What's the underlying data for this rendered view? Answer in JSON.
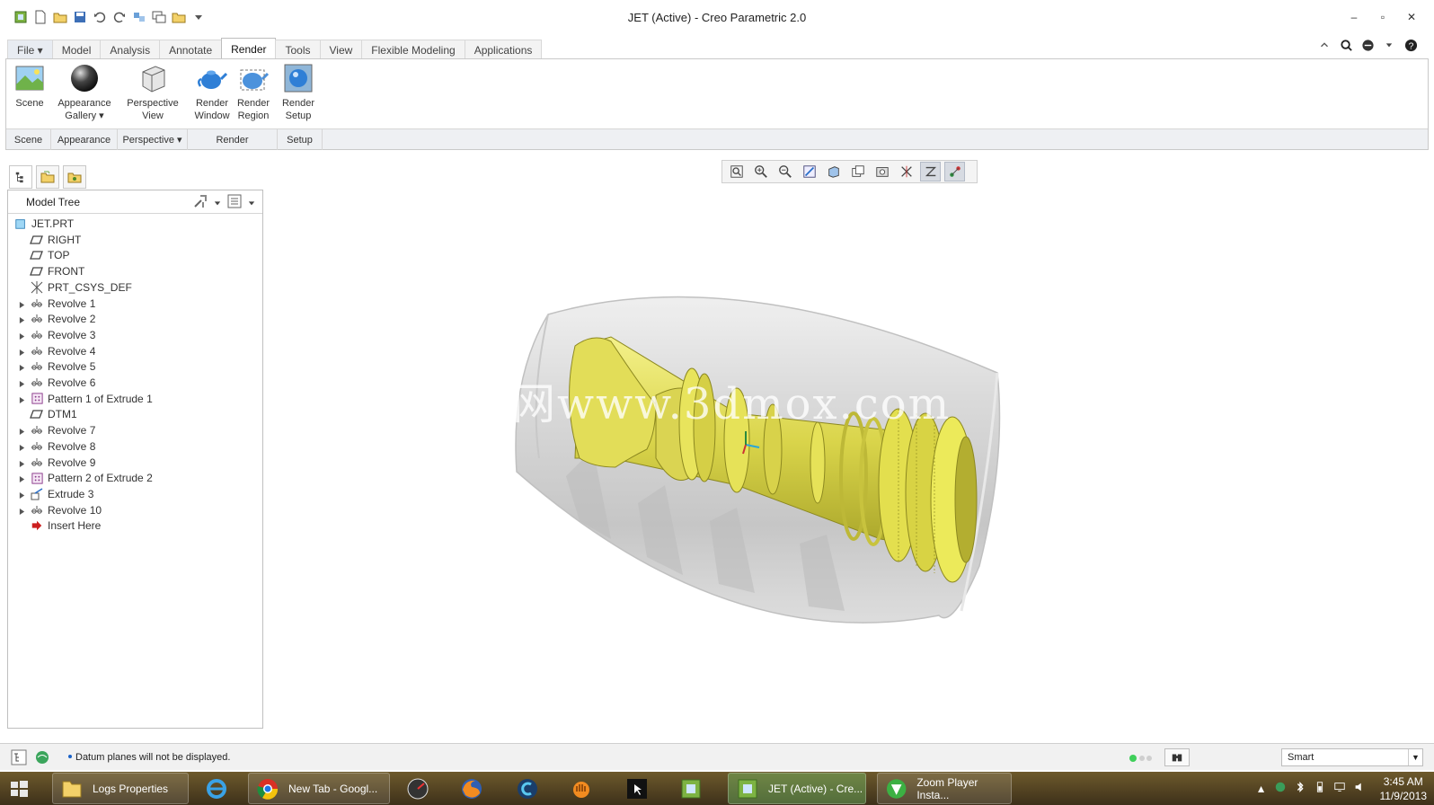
{
  "window": {
    "title": "JET (Active) - Creo Parametric 2.0"
  },
  "tabs": [
    {
      "label": "File ▾",
      "name": "tab-file"
    },
    {
      "label": "Model",
      "name": "tab-model"
    },
    {
      "label": "Analysis",
      "name": "tab-analysis"
    },
    {
      "label": "Annotate",
      "name": "tab-annotate"
    },
    {
      "label": "Render",
      "name": "tab-render",
      "active": true
    },
    {
      "label": "Tools",
      "name": "tab-tools"
    },
    {
      "label": "View",
      "name": "tab-view"
    },
    {
      "label": "Flexible Modeling",
      "name": "tab-flexible-modeling"
    },
    {
      "label": "Applications",
      "name": "tab-applications"
    }
  ],
  "ribbon": {
    "scene": "Scene",
    "appearance_l1": "Appearance",
    "appearance_l2": "Gallery ▾",
    "perspective_l1": "Perspective",
    "perspective_l2": "View",
    "render_window_l1": "Render",
    "render_window_l2": "Window",
    "render_region_l1": "Render",
    "render_region_l2": "Region",
    "render_setup_l1": "Render",
    "render_setup_l2": "Setup",
    "groups": {
      "scene": "Scene",
      "appearance": "Appearance",
      "perspective": "Perspective ▾",
      "render": "Render",
      "setup": "Setup"
    }
  },
  "model_tree": {
    "title": "Model Tree",
    "items": [
      {
        "label": "JET.PRT",
        "icon": "part-icon",
        "expandable": false
      },
      {
        "label": "RIGHT",
        "icon": "datum-plane-icon",
        "expandable": false
      },
      {
        "label": "TOP",
        "icon": "datum-plane-icon",
        "expandable": false
      },
      {
        "label": "FRONT",
        "icon": "datum-plane-icon",
        "expandable": false
      },
      {
        "label": "PRT_CSYS_DEF",
        "icon": "csys-icon",
        "expandable": false
      },
      {
        "label": "Revolve 1",
        "icon": "revolve-icon",
        "expandable": true
      },
      {
        "label": "Revolve 2",
        "icon": "revolve-icon",
        "expandable": true
      },
      {
        "label": "Revolve 3",
        "icon": "revolve-icon",
        "expandable": true
      },
      {
        "label": "Revolve 4",
        "icon": "revolve-icon",
        "expandable": true
      },
      {
        "label": "Revolve 5",
        "icon": "revolve-icon",
        "expandable": true
      },
      {
        "label": "Revolve 6",
        "icon": "revolve-icon",
        "expandable": true
      },
      {
        "label": "Pattern 1 of Extrude 1",
        "icon": "pattern-icon",
        "expandable": true
      },
      {
        "label": "DTM1",
        "icon": "datum-plane-icon",
        "expandable": false
      },
      {
        "label": "Revolve 7",
        "icon": "revolve-icon",
        "expandable": true
      },
      {
        "label": "Revolve 8",
        "icon": "revolve-icon",
        "expandable": true
      },
      {
        "label": "Revolve 9",
        "icon": "revolve-icon",
        "expandable": true
      },
      {
        "label": "Pattern 2 of Extrude 2",
        "icon": "pattern-icon",
        "expandable": true
      },
      {
        "label": "Extrude 3",
        "icon": "extrude-icon",
        "expandable": true
      },
      {
        "label": "Revolve 10",
        "icon": "revolve-icon",
        "expandable": true
      },
      {
        "label": "Insert Here",
        "icon": "insert-here-icon",
        "expandable": false
      }
    ]
  },
  "viewport": {
    "watermark": "西网www.3dmox.com"
  },
  "status": {
    "message": "Datum planes will not be displayed.",
    "filter": "Smart"
  },
  "taskbar": {
    "apps": [
      {
        "label": "Logs Properties"
      },
      {
        "label": "New Tab - Googl..."
      },
      {
        "label": "JET (Active) - Cre..."
      },
      {
        "label": "Zoom Player Insta..."
      }
    ],
    "time": "3:45 AM",
    "date": "11/9/2013"
  },
  "colors": {
    "model_yellow": "#e6e25a",
    "housing_gray": "#cfcfcf",
    "active_tab_bg": "#ffffff",
    "taskbar": "#5a4825"
  }
}
